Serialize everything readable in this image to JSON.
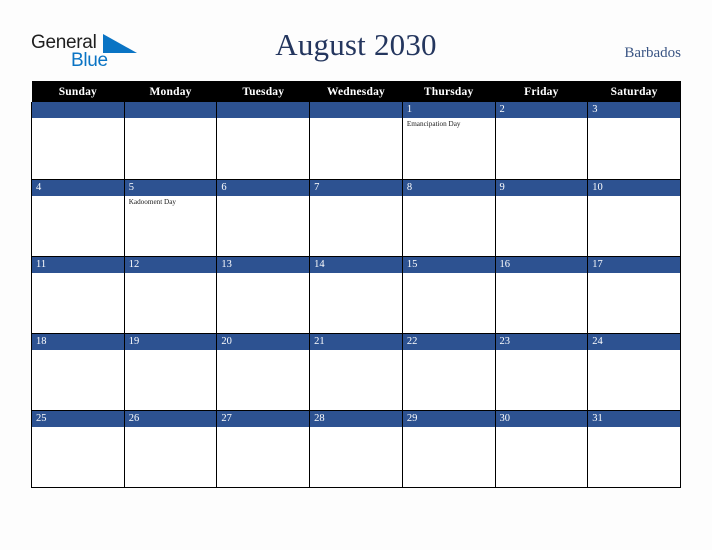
{
  "brand": {
    "logo_text_primary": "General",
    "logo_text_secondary": "Blue",
    "logo_icon": "triangle-flag-icon",
    "primary_color": "#0a74c4",
    "text_color": "#1f1f1f"
  },
  "header": {
    "title": "August 2030",
    "month": "August",
    "year": "2030",
    "country": "Barbados",
    "title_color": "#24365e",
    "country_color": "#3a5584"
  },
  "calendar": {
    "accent_color": "#2d5291",
    "header_bg": "#000000",
    "header_text_color": "#ffffff",
    "cell_bg": "#ffffff",
    "weekdays": [
      "Sunday",
      "Monday",
      "Tuesday",
      "Wednesday",
      "Thursday",
      "Friday",
      "Saturday"
    ],
    "weeks": [
      [
        {
          "day": "",
          "events": []
        },
        {
          "day": "",
          "events": []
        },
        {
          "day": "",
          "events": []
        },
        {
          "day": "",
          "events": []
        },
        {
          "day": "1",
          "events": [
            "Emancipation Day"
          ]
        },
        {
          "day": "2",
          "events": []
        },
        {
          "day": "3",
          "events": []
        }
      ],
      [
        {
          "day": "4",
          "events": []
        },
        {
          "day": "5",
          "events": [
            "Kadooment Day"
          ]
        },
        {
          "day": "6",
          "events": []
        },
        {
          "day": "7",
          "events": []
        },
        {
          "day": "8",
          "events": []
        },
        {
          "day": "9",
          "events": []
        },
        {
          "day": "10",
          "events": []
        }
      ],
      [
        {
          "day": "11",
          "events": []
        },
        {
          "day": "12",
          "events": []
        },
        {
          "day": "13",
          "events": []
        },
        {
          "day": "14",
          "events": []
        },
        {
          "day": "15",
          "events": []
        },
        {
          "day": "16",
          "events": []
        },
        {
          "day": "17",
          "events": []
        }
      ],
      [
        {
          "day": "18",
          "events": []
        },
        {
          "day": "19",
          "events": []
        },
        {
          "day": "20",
          "events": []
        },
        {
          "day": "21",
          "events": []
        },
        {
          "day": "22",
          "events": []
        },
        {
          "day": "23",
          "events": []
        },
        {
          "day": "24",
          "events": []
        }
      ],
      [
        {
          "day": "25",
          "events": []
        },
        {
          "day": "26",
          "events": []
        },
        {
          "day": "27",
          "events": []
        },
        {
          "day": "28",
          "events": []
        },
        {
          "day": "29",
          "events": []
        },
        {
          "day": "30",
          "events": []
        },
        {
          "day": "31",
          "events": []
        }
      ]
    ]
  }
}
